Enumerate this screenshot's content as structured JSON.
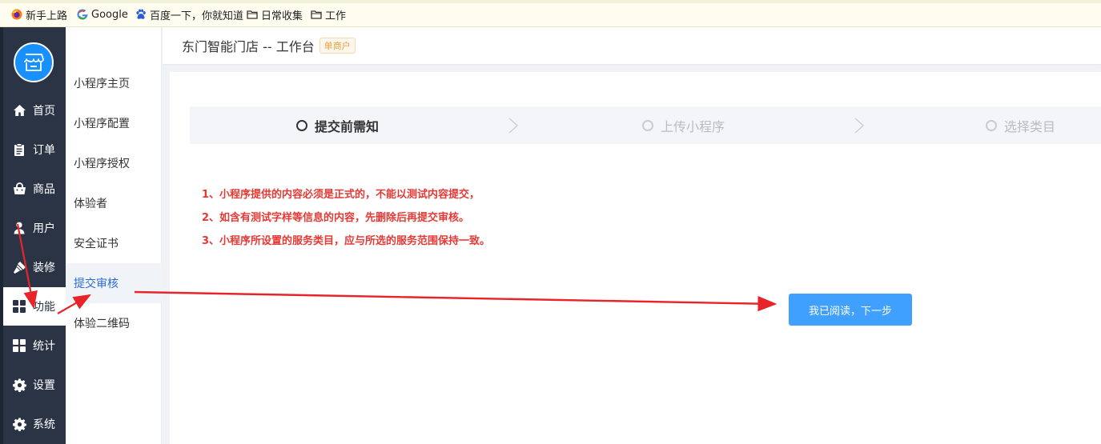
{
  "bookmarks": [
    {
      "icon": "firefox-icon",
      "label": "新手上路"
    },
    {
      "icon": "google-icon",
      "label": "Google"
    },
    {
      "icon": "baidu-paw-icon",
      "label": "百度一下，你就知道"
    },
    {
      "icon": "folder-icon",
      "label": "日常收集"
    },
    {
      "icon": "folder-icon",
      "label": "工作"
    }
  ],
  "sidebar": {
    "logo_icon": "store-icon",
    "items": [
      {
        "icon": "home-icon",
        "label": "首页",
        "active": false
      },
      {
        "icon": "clipboard-icon",
        "label": "订单",
        "active": false
      },
      {
        "icon": "shopping-bag-icon",
        "label": "商品",
        "active": false
      },
      {
        "icon": "user-icon",
        "label": "用户",
        "active": false
      },
      {
        "icon": "brush-icon",
        "label": "装修",
        "active": false
      },
      {
        "icon": "grid-icon",
        "label": "功能",
        "active": true
      },
      {
        "icon": "grid-icon",
        "label": "统计",
        "active": false
      },
      {
        "icon": "gear-icon",
        "label": "设置",
        "active": false
      },
      {
        "icon": "gear-icon",
        "label": "系统",
        "active": false
      }
    ]
  },
  "submenu": {
    "items": [
      {
        "label": "小程序主页",
        "active": false
      },
      {
        "label": "小程序配置",
        "active": false
      },
      {
        "label": "小程序授权",
        "active": false
      },
      {
        "label": "体验者",
        "active": false
      },
      {
        "label": "安全证书",
        "active": false
      },
      {
        "label": "提交审核",
        "active": true
      },
      {
        "label": "体验二维码",
        "active": false
      }
    ]
  },
  "header": {
    "title": "东门智能门店 -- 工作台",
    "badge": "单商户"
  },
  "steps": [
    {
      "label": "提交前需知",
      "active": true
    },
    {
      "label": "上传小程序",
      "active": false
    },
    {
      "label": "选择类目",
      "active": false
    }
  ],
  "notices": [
    "1、小程序提供的内容必须是正式的，不能以测试内容提交，",
    "2、如含有测试字样等信息的内容，先删除后再提交审核。",
    "3、小程序所设置的服务类目，应与所选的服务范围保持一致。"
  ],
  "next_button": "我已阅读，下一步",
  "colors": {
    "sidebar_bg": "#2b3445",
    "primary": "#40a0ff",
    "notice_red": "#e53935",
    "annotation_arrow": "#e8232a",
    "badge_orange": "#e6a23c"
  }
}
